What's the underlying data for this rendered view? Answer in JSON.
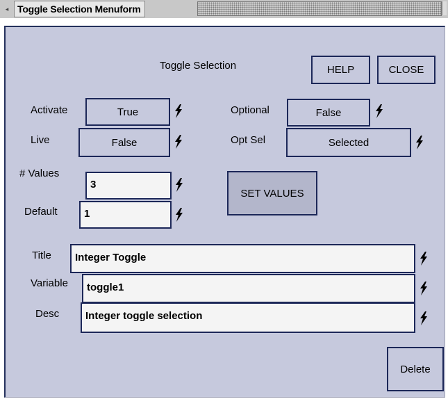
{
  "window": {
    "title": "Toggle Selection Menuform",
    "minimize_glyph": "◂"
  },
  "form": {
    "heading": "Toggle Selection",
    "help_label": "HELP",
    "close_label": "CLOSE",
    "activate": {
      "label": "Activate",
      "value": "True"
    },
    "optional": {
      "label": "Optional",
      "value": "False"
    },
    "live": {
      "label": "Live",
      "value": "False"
    },
    "opt_sel": {
      "label": "Opt Sel",
      "value": "Selected"
    },
    "num_values": {
      "label": "# Values",
      "value": "3"
    },
    "default": {
      "label": "Default",
      "value": "1"
    },
    "set_values_label": "SET VALUES",
    "title_field": {
      "label": "Title",
      "value": "Integer Toggle"
    },
    "variable_field": {
      "label": "Variable",
      "value": "toggle1"
    },
    "desc_field": {
      "label": "Desc",
      "value": "Integer toggle selection"
    },
    "delete_label": "Delete"
  },
  "icons": {
    "field_action": "lightning-bolt-icon"
  },
  "colors": {
    "panel_bg": "#c6c9dd",
    "border_dark": "#1c2758",
    "field_bg": "#f4f4f4",
    "titlebar_bg": "#c8c8c8"
  }
}
